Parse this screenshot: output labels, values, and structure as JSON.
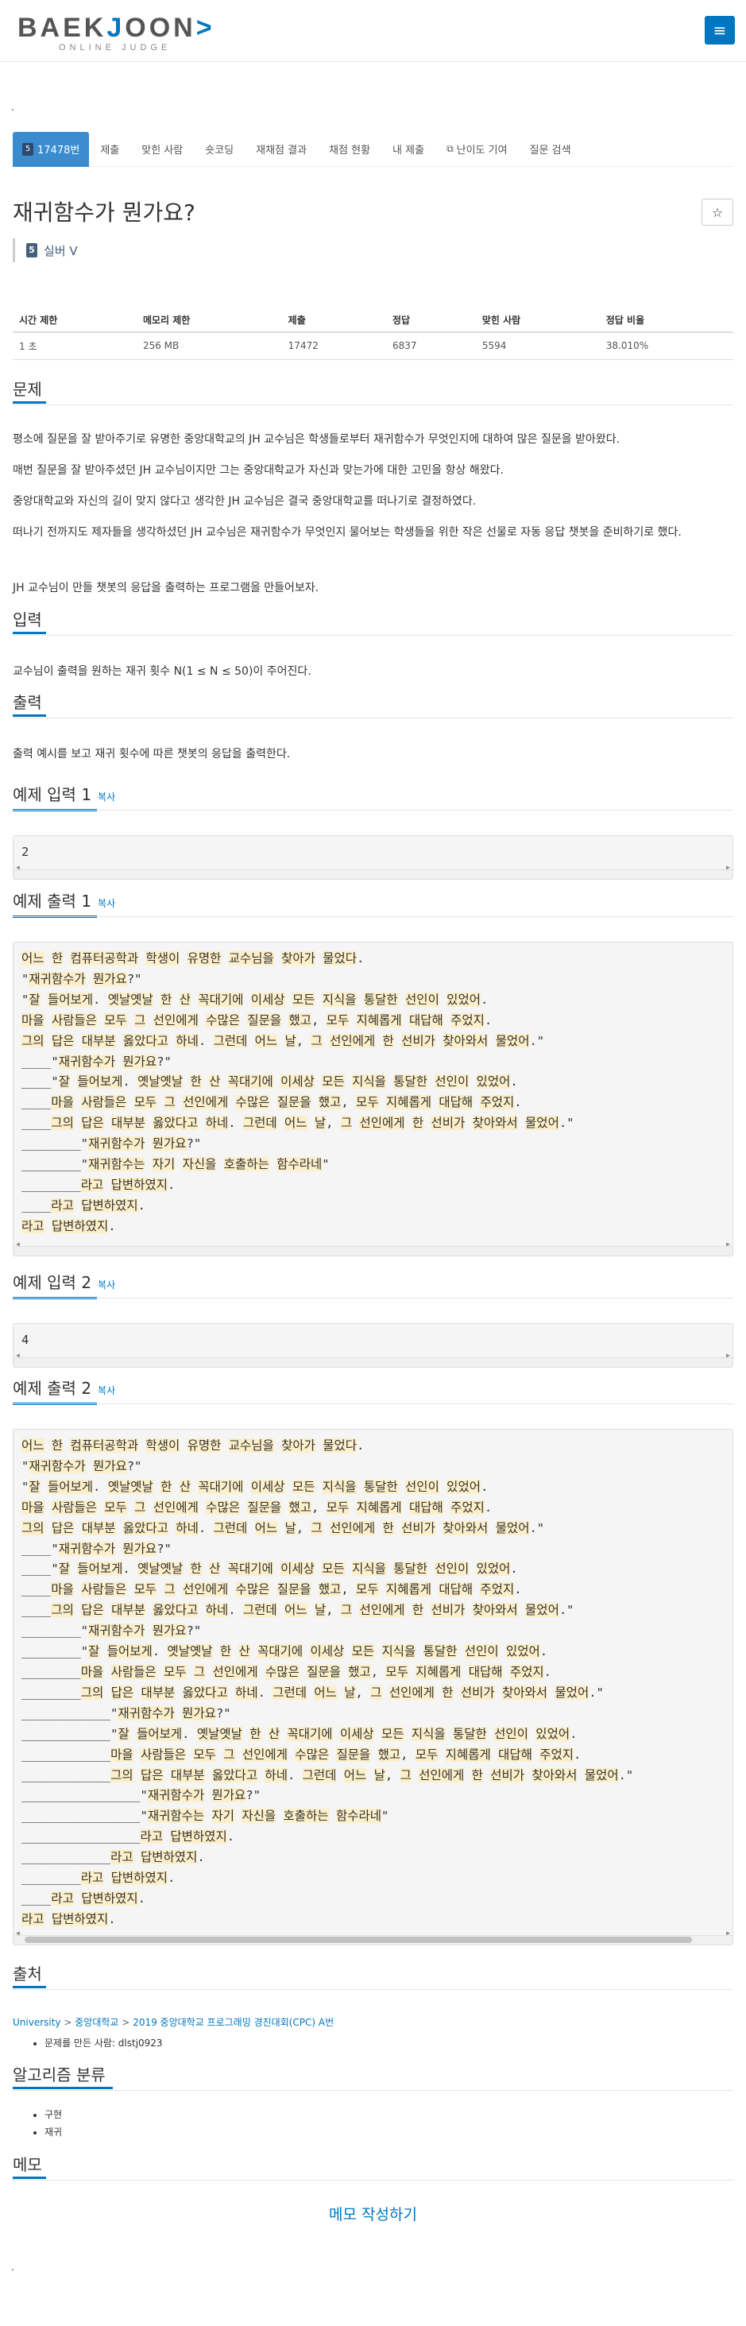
{
  "header": {
    "logo_main_left": "BAEK",
    "logo_main_accent": "J",
    "logo_main_right": "OON",
    "logo_sub": "ONLINE JUDGE",
    "menu_icon": "hamburger-icon"
  },
  "dot_text": ".",
  "tabs": [
    {
      "label": "17478번",
      "active": true,
      "icon": "problem-badge-icon"
    },
    {
      "label": "제출"
    },
    {
      "label": "맞힌 사람"
    },
    {
      "label": "숏코딩"
    },
    {
      "label": "재채점 결과"
    },
    {
      "label": "채점 현황"
    },
    {
      "label": "내 제출"
    },
    {
      "label": "난이도 기여",
      "icon": "external-link-icon"
    },
    {
      "label": "질문 검색"
    }
  ],
  "title": "재귀함수가 뭔가요?",
  "star_icon": "star-icon",
  "tier": {
    "label": "실버 V",
    "icon_text": "5"
  },
  "info_table": {
    "headers": [
      "시간 제한",
      "메모리 제한",
      "제출",
      "정답",
      "맞힌 사람",
      "정답 비율"
    ],
    "values": [
      "1 초",
      "256 MB",
      "17472",
      "6837",
      "5594",
      "38.010%"
    ]
  },
  "sections": {
    "problem": "문제",
    "input": "입력",
    "output": "출력",
    "sample_input_1": "예제 입력 1",
    "sample_output_1": "예제 출력 1",
    "sample_input_2": "예제 입력 2",
    "sample_output_2": "예제 출력 2",
    "source": "출처",
    "algorithm": "알고리즘 분류",
    "memo": "메모",
    "copy": "복사"
  },
  "problem_paragraphs": [
    "평소에 질문을 잘 받아주기로 유명한 중앙대학교의 JH 교수님은 학생들로부터 재귀함수가 무엇인지에 대하여 많은 질문을 받아왔다.",
    "매번 질문을 잘 받아주셨던 JH 교수님이지만 그는 중앙대학교가 자신과 맞는가에 대한 고민을 항상 해왔다.",
    "중앙대학교와 자신의 길이 맞지 않다고 생각한 JH 교수님은 결국 중앙대학교를 떠나기로 결정하였다.",
    "떠나기 전까지도 제자들을 생각하셨던 JH 교수님은 재귀함수가 무엇인지 물어보는 학생들을 위한 작은 선물로 자동 응답 챗봇을 준비하기로 했다.",
    "JH 교수님이 만들 챗봇의 응답을 출력하는 프로그램을 만들어보자."
  ],
  "input_text": "교수님이 출력을 원하는 재귀 횟수 N(1 ≤ N ≤ 50)이 주어진다.",
  "output_text": "출력 예시를 보고 재귀 횟수에 따른 챗봇의 응답을 출력한다.",
  "sample_input_1": "2",
  "sample_output_1": [
    "어느 한 컴퓨터공학과 학생이 유명한 교수님을 찾아가 물었다.",
    "\"재귀함수가 뭔가요?\"",
    "\"잘 들어보게. 옛날옛날 한 산 꼭대기에 이세상 모든 지식을 통달한 선인이 있었어.",
    "마을 사람들은 모두 그 선인에게 수많은 질문을 했고, 모두 지혜롭게 대답해 주었지.",
    "그의 답은 대부분 옳았다고 하네. 그런데 어느 날, 그 선인에게 한 선비가 찾아와서 물었어.\"",
    "____\"재귀함수가 뭔가요?\"",
    "____\"잘 들어보게. 옛날옛날 한 산 꼭대기에 이세상 모든 지식을 통달한 선인이 있었어.",
    "____마을 사람들은 모두 그 선인에게 수많은 질문을 했고, 모두 지혜롭게 대답해 주었지.",
    "____그의 답은 대부분 옳았다고 하네. 그런데 어느 날, 그 선인에게 한 선비가 찾아와서 물었어.\"",
    "________\"재귀함수가 뭔가요?\"",
    "________\"재귀함수는 자기 자신을 호출하는 함수라네\"",
    "________라고 답변하였지.",
    "____라고 답변하였지.",
    "라고 답변하였지."
  ],
  "sample_input_2": "4",
  "sample_output_2": [
    "어느 한 컴퓨터공학과 학생이 유명한 교수님을 찾아가 물었다.",
    "\"재귀함수가 뭔가요?\"",
    "\"잘 들어보게. 옛날옛날 한 산 꼭대기에 이세상 모든 지식을 통달한 선인이 있었어.",
    "마을 사람들은 모두 그 선인에게 수많은 질문을 했고, 모두 지혜롭게 대답해 주었지.",
    "그의 답은 대부분 옳았다고 하네. 그런데 어느 날, 그 선인에게 한 선비가 찾아와서 물었어.\"",
    "____\"재귀함수가 뭔가요?\"",
    "____\"잘 들어보게. 옛날옛날 한 산 꼭대기에 이세상 모든 지식을 통달한 선인이 있었어.",
    "____마을 사람들은 모두 그 선인에게 수많은 질문을 했고, 모두 지혜롭게 대답해 주었지.",
    "____그의 답은 대부분 옳았다고 하네. 그런데 어느 날, 그 선인에게 한 선비가 찾아와서 물었어.\"",
    "________\"재귀함수가 뭔가요?\"",
    "________\"잘 들어보게. 옛날옛날 한 산 꼭대기에 이세상 모든 지식을 통달한 선인이 있었어.",
    "________마을 사람들은 모두 그 선인에게 수많은 질문을 했고, 모두 지혜롭게 대답해 주었지.",
    "________그의 답은 대부분 옳았다고 하네. 그런데 어느 날, 그 선인에게 한 선비가 찾아와서 물었어.\"",
    "____________\"재귀함수가 뭔가요?\"",
    "____________\"잘 들어보게. 옛날옛날 한 산 꼭대기에 이세상 모든 지식을 통달한 선인이 있었어.",
    "____________마을 사람들은 모두 그 선인에게 수많은 질문을 했고, 모두 지혜롭게 대답해 주었지.",
    "____________그의 답은 대부분 옳았다고 하네. 그런데 어느 날, 그 선인에게 한 선비가 찾아와서 물었어.\"",
    "________________\"재귀함수가 뭔가요?\"",
    "________________\"재귀함수는 자기 자신을 호출하는 함수라네\"",
    "________________라고 답변하였지.",
    "____________라고 답변하였지.",
    "________라고 답변하였지.",
    "____라고 답변하였지.",
    "라고 답변하였지."
  ],
  "source": {
    "links": [
      "University",
      "중앙대학교",
      "2019 중앙대학교 프로그래밍 경진대회(CPC)",
      "A번"
    ],
    "separator": ">",
    "maker_label": "문제를 만든 사람:",
    "maker": "dlstj0923"
  },
  "algorithms": [
    "구현",
    "재귀"
  ],
  "memo_button": "메모 작성하기",
  "colors": {
    "accent": "#0076c0",
    "tab_active": "#3a8ccf",
    "highlight": "#fcefc9"
  }
}
